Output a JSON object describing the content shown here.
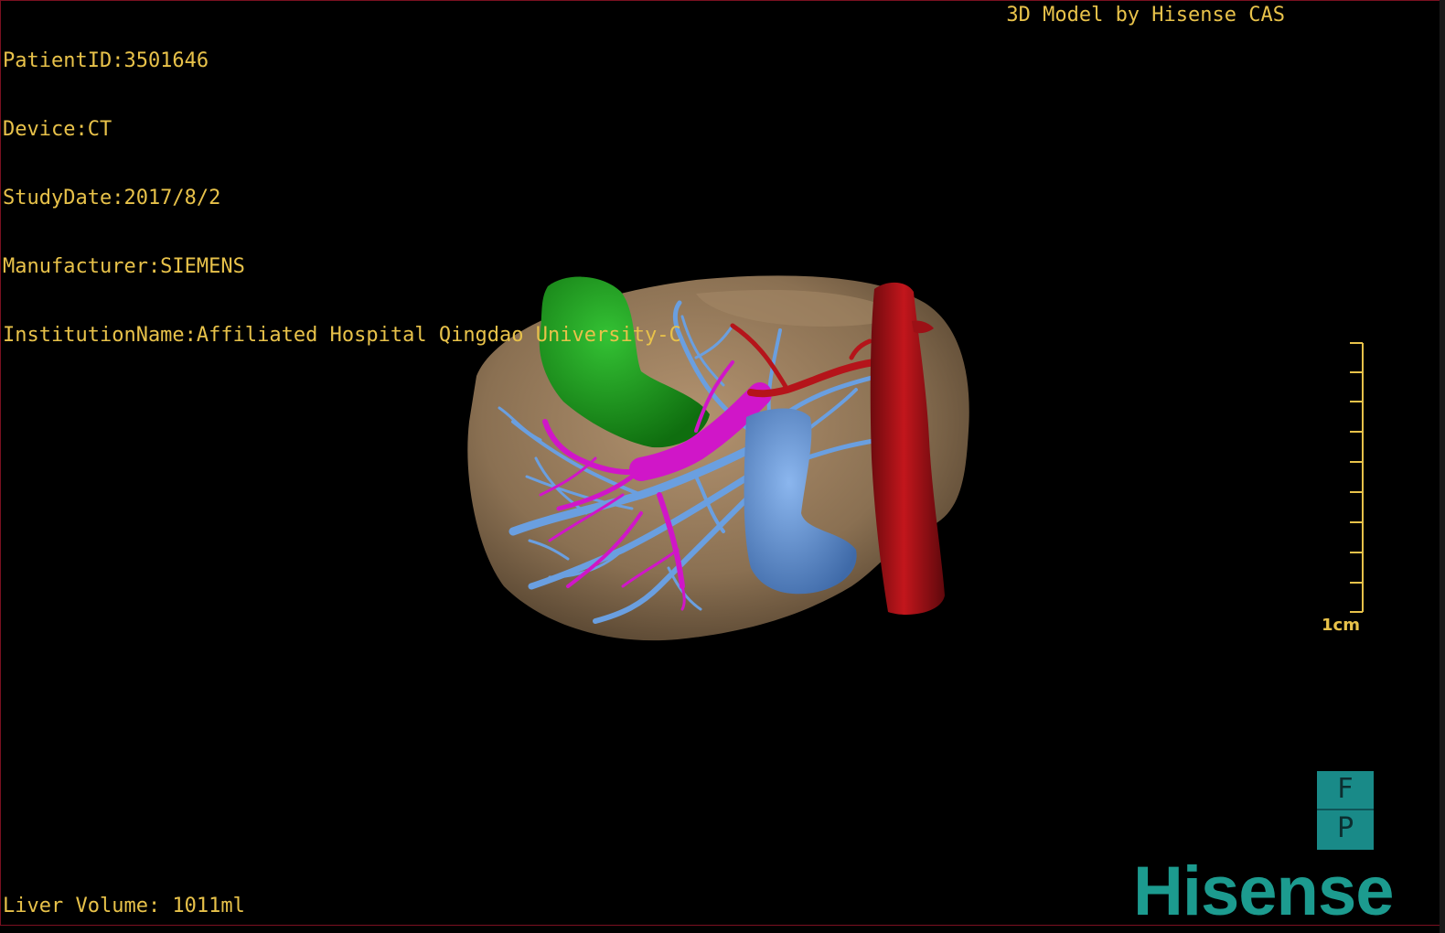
{
  "info": {
    "patient_id": "PatientID:3501646",
    "device": "Device:CT",
    "study_date": "StudyDate:2017/8/2",
    "manufacturer": "Manufacturer:SIEMENS",
    "institution": "InstitutionName:Affiliated Hospital Qingdao University-C"
  },
  "credit": "3D Model by Hisense CAS",
  "liver_volume": "Liver Volume: 1011ml",
  "scale_bar": {
    "label": "1cm"
  },
  "orientation": {
    "top": "F",
    "bottom": "P"
  },
  "brand": "Hisense",
  "colors": {
    "text": "#e8c24a",
    "liver": "#8a7052",
    "gallbladder": "#1e9a1e",
    "portal_vein": "#d016c8",
    "hepatic_vein": "#6a9fe0",
    "artery": "#b5141a",
    "brand": "#1c9b8f"
  }
}
